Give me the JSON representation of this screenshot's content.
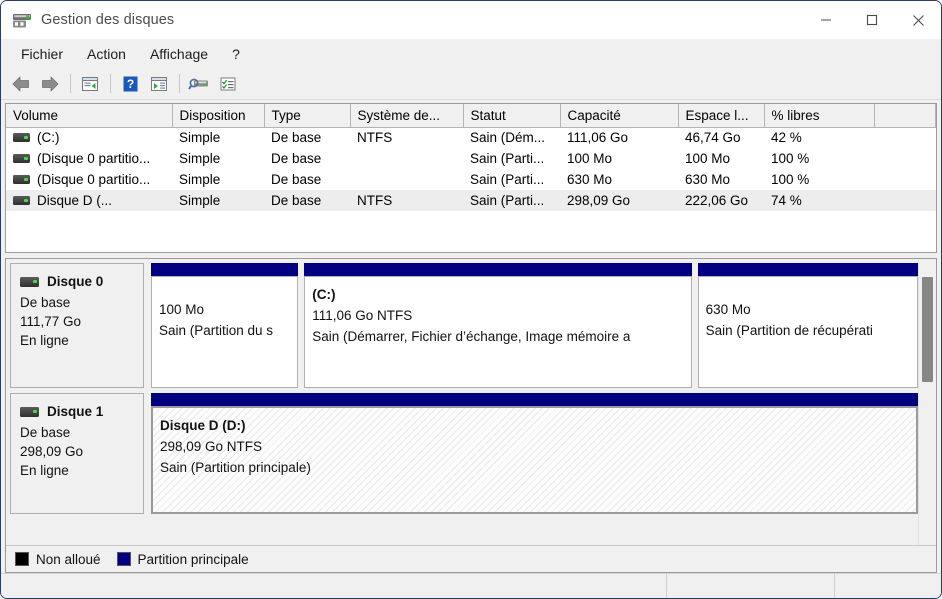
{
  "window": {
    "title": "Gestion des disques",
    "icon": "disk-management-icon",
    "minimize_label": "—",
    "maximize_label": "□",
    "close_label": "✕"
  },
  "menubar": {
    "items": [
      {
        "label": "Fichier",
        "name": "menu-fichier"
      },
      {
        "label": "Action",
        "name": "menu-action"
      },
      {
        "label": "Affichage",
        "name": "menu-affichage"
      },
      {
        "label": "?",
        "name": "menu-aide"
      }
    ]
  },
  "toolbar": {
    "buttons": [
      {
        "name": "back-icon",
        "title": "Précédent"
      },
      {
        "name": "forward-icon",
        "title": "Suivant"
      },
      {
        "name": "up-one-level-icon",
        "title": "Remonter d'un niveau"
      },
      {
        "name": "help-icon",
        "title": "Aide"
      },
      {
        "name": "show-hide-console-tree-icon",
        "title": "Afficher/Masquer l'arborescence"
      },
      {
        "name": "rescan-disks-icon",
        "title": "Réanalyser les disques"
      },
      {
        "name": "properties-icon",
        "title": "Propriétés"
      }
    ]
  },
  "volume_list": {
    "columns": [
      "Volume",
      "Disposition",
      "Type",
      "Système de...",
      "Statut",
      "Capacité",
      "Espace l...",
      "% libres"
    ],
    "rows": [
      {
        "volume": "(C:)",
        "disposition": "Simple",
        "type": "De base",
        "filesystem": "NTFS",
        "statut": "Sain (Dém...",
        "capacite": "111,06 Go",
        "espace_libre": "46,74 Go",
        "pct_libres": "42 %",
        "selected": false
      },
      {
        "volume": "(Disque 0 partitio...",
        "disposition": "Simple",
        "type": "De base",
        "filesystem": "",
        "statut": "Sain (Parti...",
        "capacite": "100 Mo",
        "espace_libre": "100 Mo",
        "pct_libres": "100 %",
        "selected": false
      },
      {
        "volume": "(Disque 0 partitio...",
        "disposition": "Simple",
        "type": "De base",
        "filesystem": "",
        "statut": "Sain (Parti...",
        "capacite": "630 Mo",
        "espace_libre": "630 Mo",
        "pct_libres": "100 %",
        "selected": false
      },
      {
        "volume": "Disque D (...",
        "disposition": "Simple",
        "type": "De base",
        "filesystem": "NTFS",
        "statut": "Sain (Parti...",
        "capacite": "298,09 Go",
        "espace_libre": "222,06 Go",
        "pct_libres": "74 %",
        "selected": true
      }
    ]
  },
  "graphic_view": {
    "disks": [
      {
        "name": "Disque 0",
        "type": "De base",
        "size": "111,77 Go",
        "status": "En ligne",
        "partitions": [
          {
            "title": "",
            "size": "100 Mo",
            "status": "Sain (Partition du s",
            "bar_color": "#000080",
            "width_pct": 19.2,
            "selected": false
          },
          {
            "title": "(C:)",
            "size": "111,06 Go NTFS",
            "status": "Sain (Démarrer, Fichier d’échange, Image mémoire a",
            "bar_color": "#000080",
            "width_pct": 50.5,
            "selected": false
          },
          {
            "title": "",
            "size": "630 Mo",
            "status": "Sain (Partition de récupérati",
            "bar_color": "#000080",
            "width_pct": 28.6,
            "selected": false
          }
        ]
      },
      {
        "name": "Disque 1",
        "type": "De base",
        "size": "298,09 Go",
        "status": "En ligne",
        "partitions": [
          {
            "title": "Disque D  (D:)",
            "size": "298,09 Go NTFS",
            "status": "Sain (Partition principale)",
            "bar_color": "#000080",
            "width_pct": 100,
            "selected": true
          }
        ]
      }
    ]
  },
  "legend": {
    "entries": [
      {
        "label": "Non alloué",
        "color": "#000000",
        "name": "legend-unallocated"
      },
      {
        "label": "Partition principale",
        "color": "#000080",
        "name": "legend-primary-partition"
      }
    ]
  },
  "statusbar": {
    "pane1": "",
    "pane2": "",
    "pane3": ""
  },
  "colors": {
    "partition_blue": "#000080",
    "unallocated_black": "#000000",
    "window_bg": "#f0f0f0",
    "accent_border": "#2b3a67"
  }
}
